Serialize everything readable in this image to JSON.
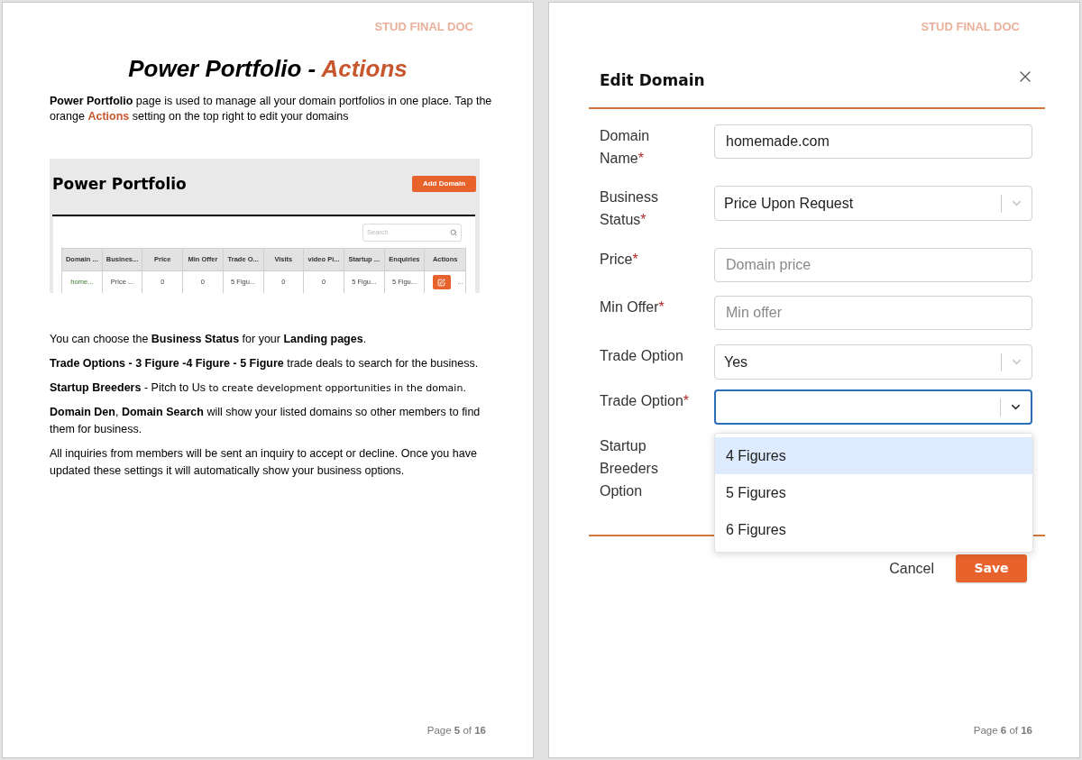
{
  "left_page": {
    "header": "STUD FINAL DOC",
    "title": [
      {
        "text": "Power Portfolio - ",
        "kind": "plain"
      },
      {
        "text": "Actions",
        "kind": "accent"
      }
    ],
    "intro": [
      {
        "text": "Power Portfolio",
        "kind": "bold"
      },
      {
        "text": " page is used to manage all your domain portfolios in one place. Tap the orange ",
        "kind": "plain"
      },
      {
        "text": "Actions",
        "kind": "accent"
      },
      {
        "text": " setting on the top right to edit your domains",
        "kind": "plain"
      }
    ],
    "app_screenshot": {
      "title": "Power Portfolio",
      "add_button": "Add Domain",
      "search": {
        "placeholder": "Search"
      },
      "table": {
        "columns": [
          "Domain ...",
          "Busines...",
          "Price",
          "Min Offer",
          "Trade O...",
          "Visits",
          "video Pi...",
          "Startup ...",
          "Enquiries",
          "Actions"
        ],
        "rows": [
          {
            "cells": [
              {
                "kind": "link",
                "text": "home..."
              },
              {
                "kind": "text",
                "text": "Price ..."
              },
              {
                "kind": "text",
                "text": "0"
              },
              {
                "kind": "text",
                "text": "0"
              },
              {
                "kind": "text",
                "text": "5 Figu..."
              },
              {
                "kind": "text",
                "text": "0"
              },
              {
                "kind": "text",
                "text": "0"
              },
              {
                "kind": "text",
                "text": "5 Figu..."
              },
              {
                "kind": "text",
                "text": "5 Figu..."
              },
              {
                "kind": "actions",
                "more": "..."
              }
            ]
          }
        ]
      }
    },
    "paragraphs": [
      [
        {
          "text": "You can choose the ",
          "kind": "plain"
        },
        {
          "text": "Business Status",
          "kind": "bold"
        },
        {
          "text": " for your ",
          "kind": "plain"
        },
        {
          "text": "Landing pages",
          "kind": "bold"
        },
        {
          "text": ".",
          "kind": "plain"
        }
      ],
      [
        {
          "text": "Trade Options - 3 Figure -4 Figure - 5 Figure",
          "kind": "bold"
        },
        {
          "text": " trade deals to search for the business.",
          "kind": "plain"
        }
      ],
      [
        {
          "text": "Startup Breeders",
          "kind": "bold"
        },
        {
          "text": " - Pitch to Us ",
          "kind": "plain"
        },
        {
          "text": "to create development opportunities in the domain.",
          "kind": "alt"
        }
      ],
      [
        {
          "text": "Domain Den",
          "kind": "bold"
        },
        {
          "text": ", ",
          "kind": "plain"
        },
        {
          "text": "Domain Search",
          "kind": "bold"
        },
        {
          "text": " will show your listed domains so other members to find them for business.",
          "kind": "plain"
        }
      ],
      [
        {
          "text": "All inquiries from members will be sent an inquiry to accept or decline. Once you have updated these settings it will automatically show your business options.",
          "kind": "plain"
        }
      ]
    ],
    "footer": "Page **5** of **16**"
  },
  "right_page": {
    "header": "STUD FINAL DOC",
    "dialog": {
      "title": "Edit Domain",
      "required_mark": "*",
      "fields": [
        {
          "label": "Domain Name",
          "required": true,
          "kind": "text",
          "value": "homemade.com",
          "focused": false
        },
        {
          "label": "Business Status",
          "required": true,
          "kind": "select",
          "value": "Price Upon Request",
          "focused": false,
          "expanded": false
        },
        {
          "label": "Price",
          "required": true,
          "kind": "text",
          "placeholder": "Domain price",
          "focused": false
        },
        {
          "label": "Min Offer",
          "required": true,
          "kind": "text",
          "placeholder": "Min offer",
          "focused": false
        },
        {
          "label": "Trade Option",
          "required": false,
          "kind": "select",
          "value": "Yes",
          "focused": false,
          "expanded": false
        },
        {
          "label": "Trade Option",
          "required": true,
          "kind": "select",
          "focused": true,
          "expanded": true,
          "options": [
            {
              "label": "4 Figures",
              "selected": true
            },
            {
              "label": "5 Figures",
              "selected": false
            },
            {
              "label": "6 Figures",
              "selected": false
            }
          ]
        },
        {
          "label": "Startup Breeders Option",
          "required": false,
          "kind": "label"
        }
      ],
      "buttons": [
        {
          "label": "Cancel",
          "kind": "secondary"
        },
        {
          "label": "Save",
          "kind": "primary"
        }
      ]
    },
    "footer": "Page **6** of **16**"
  }
}
